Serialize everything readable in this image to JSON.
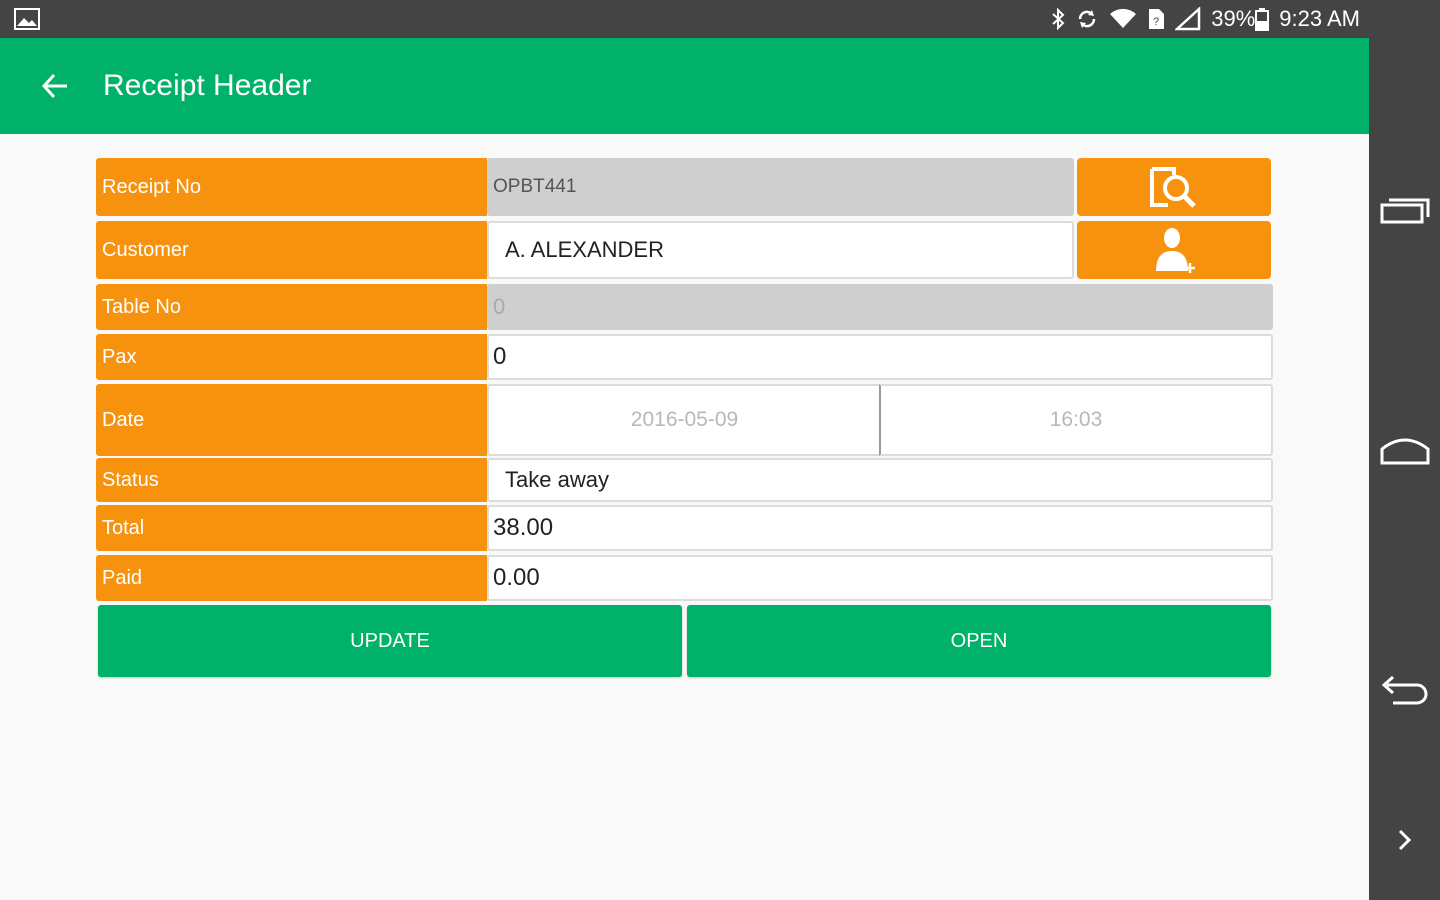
{
  "status_bar": {
    "battery": "39%",
    "time": "9:23 AM"
  },
  "app_bar": {
    "title": "Receipt Header"
  },
  "form": {
    "receipt_no": {
      "label": "Receipt No",
      "value": "OPBT441"
    },
    "customer": {
      "label": "Customer",
      "value": "A. ALEXANDER"
    },
    "table_no": {
      "label": "Table No",
      "value": "0"
    },
    "pax": {
      "label": "Pax",
      "value": "0"
    },
    "date": {
      "label": "Date",
      "date_value": "2016-05-09",
      "time_value": "16:03"
    },
    "status": {
      "label": "Status",
      "value": "Take away"
    },
    "total": {
      "label": "Total",
      "value": "38.00"
    },
    "paid": {
      "label": "Paid",
      "value": "0.00"
    }
  },
  "actions": {
    "update_label": "UPDATE",
    "open_label": "OPEN"
  },
  "colors": {
    "primary_green": "#00b16a",
    "label_orange": "#f7920f",
    "system_bar": "#444444"
  }
}
